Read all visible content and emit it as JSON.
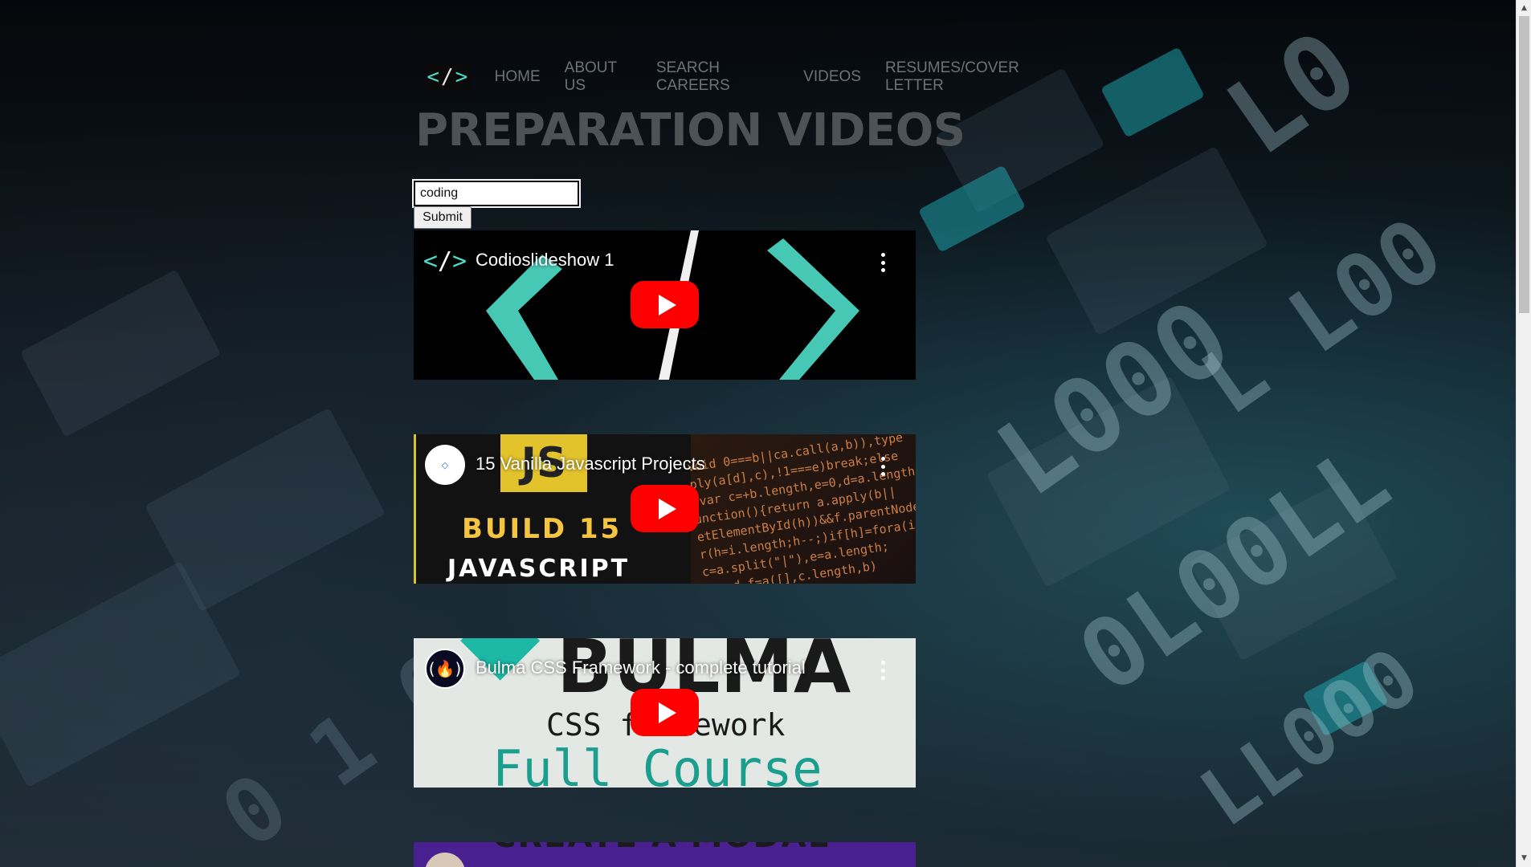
{
  "nav": {
    "logo": {
      "left": "<",
      "slash": "/",
      "right": ">"
    },
    "links": [
      "HOME",
      "ABOUT US",
      "SEARCH CAREERS",
      "VIDEOS",
      "RESUMES/COVER LETTER"
    ]
  },
  "page_title": "PREPARATION VIDEOS",
  "search": {
    "value": "coding",
    "submit_label": "Submit"
  },
  "videos": [
    {
      "title": "Codioslideshow 1",
      "thumb_text": ""
    },
    {
      "title": "15 Vanilla Javascript Projects",
      "thumb_text_1": "JS",
      "thumb_text_2": "BUILD 15",
      "thumb_text_3": "JAVASCRIPT"
    },
    {
      "title": "Bulma CSS Framework - complete tutorial",
      "thumb_text_1": "BULMA",
      "thumb_text_2": "CSS framework",
      "thumb_text_3": "Full Course"
    },
    {
      "title": "",
      "thumb_text_1": "CREATE A MODAL"
    }
  ],
  "colors": {
    "teal": "#4fd8c4",
    "youtube_red": "#ff0000",
    "nav_text": "#6c7278",
    "title_text": "#4d5257"
  }
}
